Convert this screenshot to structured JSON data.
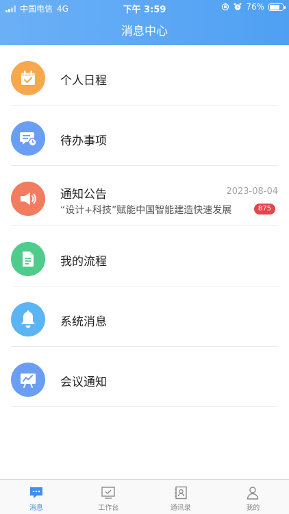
{
  "status_bar": {
    "carrier": "中国电信",
    "network": "4G",
    "time": "下午 3:59",
    "battery": "76%",
    "battery_level": 0.76
  },
  "header": {
    "title": "消息中心"
  },
  "items": [
    {
      "label": "个人日程",
      "icon": "calendar-check-icon",
      "color": "#f7a84d"
    },
    {
      "label": "待办事项",
      "icon": "message-clock-icon",
      "color": "#6a9ef5"
    },
    {
      "label": "通知公告",
      "icon": "megaphone-icon",
      "color": "#f27c5f",
      "subtitle": "“设计+科技”赋能中国智能建造快速发展",
      "date": "2023-08-04",
      "badge": "875"
    },
    {
      "label": "我的流程",
      "icon": "document-icon",
      "color": "#4fcc8b"
    },
    {
      "label": "系统消息",
      "icon": "bell-icon",
      "color": "#5bb5f4"
    },
    {
      "label": "会议通知",
      "icon": "presentation-board-icon",
      "color": "#6a9ef5"
    }
  ],
  "tabs": [
    {
      "label": "消息",
      "icon": "chat-bubble-icon",
      "active": true
    },
    {
      "label": "工作台",
      "icon": "monitor-check-icon",
      "active": false
    },
    {
      "label": "通讯录",
      "icon": "contacts-book-icon",
      "active": false
    },
    {
      "label": "我的",
      "icon": "person-icon",
      "active": false
    }
  ],
  "colors": {
    "accent": "#3e8ef0",
    "badge": "#e0474a"
  }
}
